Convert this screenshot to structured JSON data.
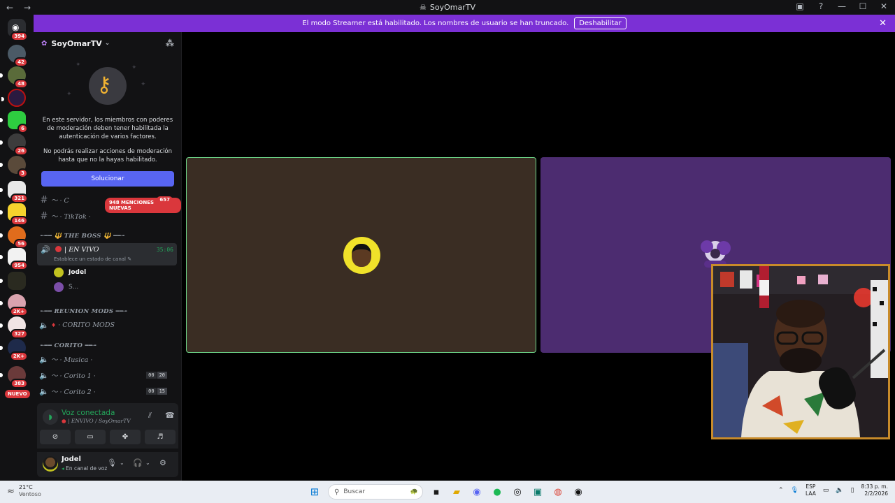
{
  "window": {
    "title": "SoyOmarTV"
  },
  "banner": {
    "text": "El modo Streamer está habilitado. Los nombres de usuario se han truncado.",
    "disable_label": "Deshabilitar"
  },
  "server_rail": {
    "home_badge": "394",
    "servers": [
      {
        "badge": "42"
      },
      {
        "badge": "48"
      },
      {
        "badge": ""
      },
      {
        "badge": "6"
      },
      {
        "badge": "26"
      },
      {
        "badge": "3"
      },
      {
        "badge": "321"
      },
      {
        "badge": "146"
      },
      {
        "badge": "56"
      },
      {
        "badge": "954"
      },
      {
        "badge": ""
      },
      {
        "badge": "2K+"
      },
      {
        "badge": "327"
      },
      {
        "badge": "2K+"
      },
      {
        "badge": "383"
      }
    ],
    "new_label": "NUEVO"
  },
  "sidebar": {
    "server_name": "SoyOmarTV",
    "mfa_text_1": "En este servidor, los miembros con poderes de moderación deben tener habilitada la autenticación de varios factores.",
    "mfa_text_2": "No podrás realizar acciones de moderación hasta que no la hayas habilitado.",
    "fix_label": "Solucionar",
    "mentions_label": "948 MENCIONES NUEVAS",
    "channel_badge": "657",
    "channels": {
      "first": "〜 · C",
      "tiktok": "〜 · TikTok ·",
      "cat_boss": "╾━━ 🔱 THE BOSS 🔱 ━━╼",
      "live_name": "| EN VIVO",
      "live_status": "Establece un estado de canal ✎",
      "live_timer": "35:06",
      "user1": "Jodel",
      "user2": "S...",
      "cat_mods": "╾━━ REUNION MODS ━━╼",
      "corito_mods": "· CORITO MODS",
      "cat_corito": "╾━━ CORITO ━━╼",
      "musica": "〜 · Musica ·",
      "corito1": "〜 · Corito 1 ·",
      "corito1_a": "00",
      "corito1_b": "20",
      "corito2": "〜 · Corito 2 ·",
      "corito2_a": "00",
      "corito2_b": "15"
    }
  },
  "voice": {
    "title": "Voz conectada",
    "subtitle": "| ENVIVO / SoyOmarTV"
  },
  "user": {
    "name": "Jodel",
    "status": "En canal de voz"
  },
  "taskbar": {
    "temp": "21°C",
    "weather": "Ventoso",
    "search_placeholder": "Buscar",
    "lang_1": "ESP",
    "lang_2": "LAA",
    "time": "8:33 p. m.",
    "date": "2/2/2026"
  },
  "colors": {
    "accent": "#5865f2",
    "streamer_banner": "#7b30d5",
    "mention_red": "#da373c",
    "voice_green": "#23a55a"
  }
}
